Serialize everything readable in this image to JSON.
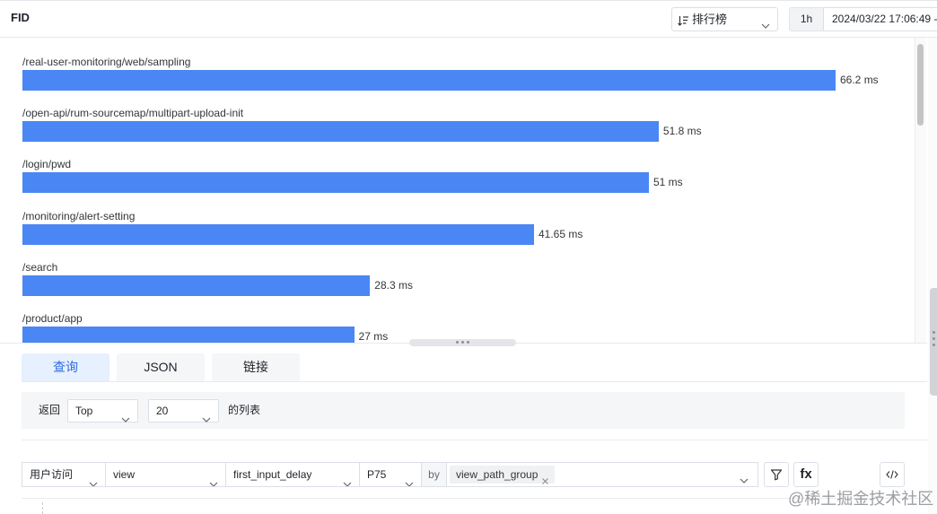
{
  "header": {
    "title": "FID",
    "view_select": {
      "icon": "sort-icon",
      "label": "排行榜",
      "chevron": "chevron-down-icon"
    },
    "time_range": "1h",
    "datetime": "2024/03/22 17:06:49 -"
  },
  "chart_data": {
    "type": "bar",
    "orientation": "horizontal",
    "categories": [
      "/real-user-monitoring/web/sampling",
      "/open-api/rum-sourcemap/multipart-upload-init",
      "/login/pwd",
      "/monitoring/alert-setting",
      "/search",
      "/product/app"
    ],
    "values": [
      66.2,
      51.8,
      51,
      41.65,
      28.3,
      27
    ],
    "unit": "ms",
    "data_labels": true,
    "grid": false,
    "legend": false,
    "color": "#4a87f4"
  },
  "tabs": [
    {
      "label": "查询",
      "active": true
    },
    {
      "label": "JSON",
      "active": false
    },
    {
      "label": "链接",
      "active": false
    }
  ],
  "list_options": {
    "prefix": "返回",
    "order": "Top",
    "count": "20",
    "suffix": "的列表"
  },
  "query": {
    "source": "用户访问",
    "object": "view",
    "metric": "first_input_delay",
    "aggregation": "P75",
    "by_label": "by",
    "group_by": [
      "view_path_group"
    ],
    "filter_icon": "filter-icon",
    "function_label": "fx",
    "code_icon": "code-icon"
  },
  "watermark": "@稀土掘金技术社区",
  "colors": {
    "accent": "#2d6ce3",
    "active_tab_bg": "#e7f0fe"
  }
}
